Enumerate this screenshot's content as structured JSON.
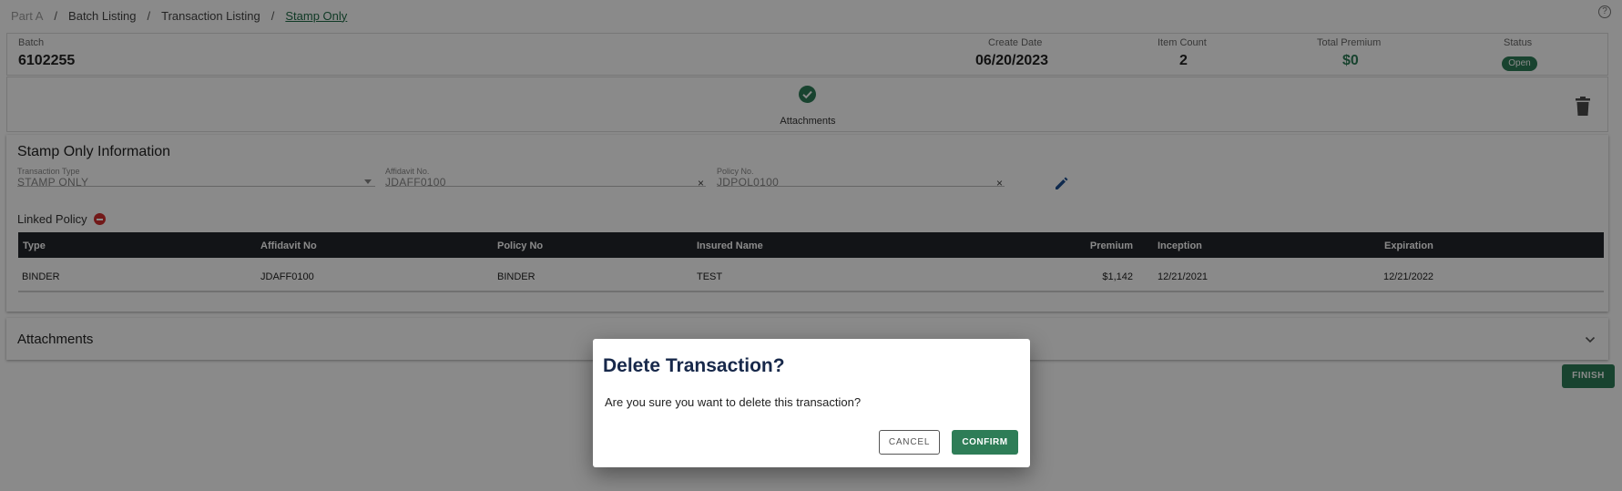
{
  "breadcrumb": {
    "items": [
      "Part A",
      "Batch Listing",
      "Transaction Listing",
      "Stamp Only"
    ],
    "separator": "/"
  },
  "help_icon": "?",
  "batch": {
    "batch_label": "Batch",
    "batch_value": "6102255",
    "create_date_label": "Create Date",
    "create_date_value": "06/20/2023",
    "item_count_label": "Item Count",
    "item_count_value": "2",
    "total_premium_label": "Total Premium",
    "total_premium_value": "$0",
    "status_label": "Status",
    "status_value": "Open"
  },
  "steps": {
    "attachments_label": "Attachments",
    "icon": "check-circle-icon"
  },
  "stamp_info": {
    "title": "Stamp Only Information",
    "transaction_type_label": "Transaction Type",
    "transaction_type_value": "STAMP ONLY",
    "affidavit_label": "Affidavit No.",
    "affidavit_value": "JDAFF0100",
    "policy_label": "Policy No.",
    "policy_value": "JDPOL0100",
    "clear_symbol": "×"
  },
  "linked_policy": {
    "label": "Linked Policy",
    "columns": [
      "Type",
      "Affidavit No",
      "Policy No",
      "Insured Name",
      "Premium",
      "Inception",
      "Expiration"
    ],
    "rows": [
      [
        "BINDER",
        "JDAFF0100",
        "BINDER",
        "TEST",
        "$1,142",
        "12/21/2021",
        "12/21/2022"
      ]
    ]
  },
  "attachments_section": {
    "title": "Attachments"
  },
  "finish_label": "FINISH",
  "dialog": {
    "title": "Delete Transaction?",
    "message": "Are you sure you want to delete this transaction?",
    "cancel_label": "CANCEL",
    "confirm_label": "CONFIRM"
  },
  "colors": {
    "accent": "#2e7d57",
    "table_header": "#22262b",
    "dialog_title": "#17284a",
    "danger": "#d32f2f"
  }
}
